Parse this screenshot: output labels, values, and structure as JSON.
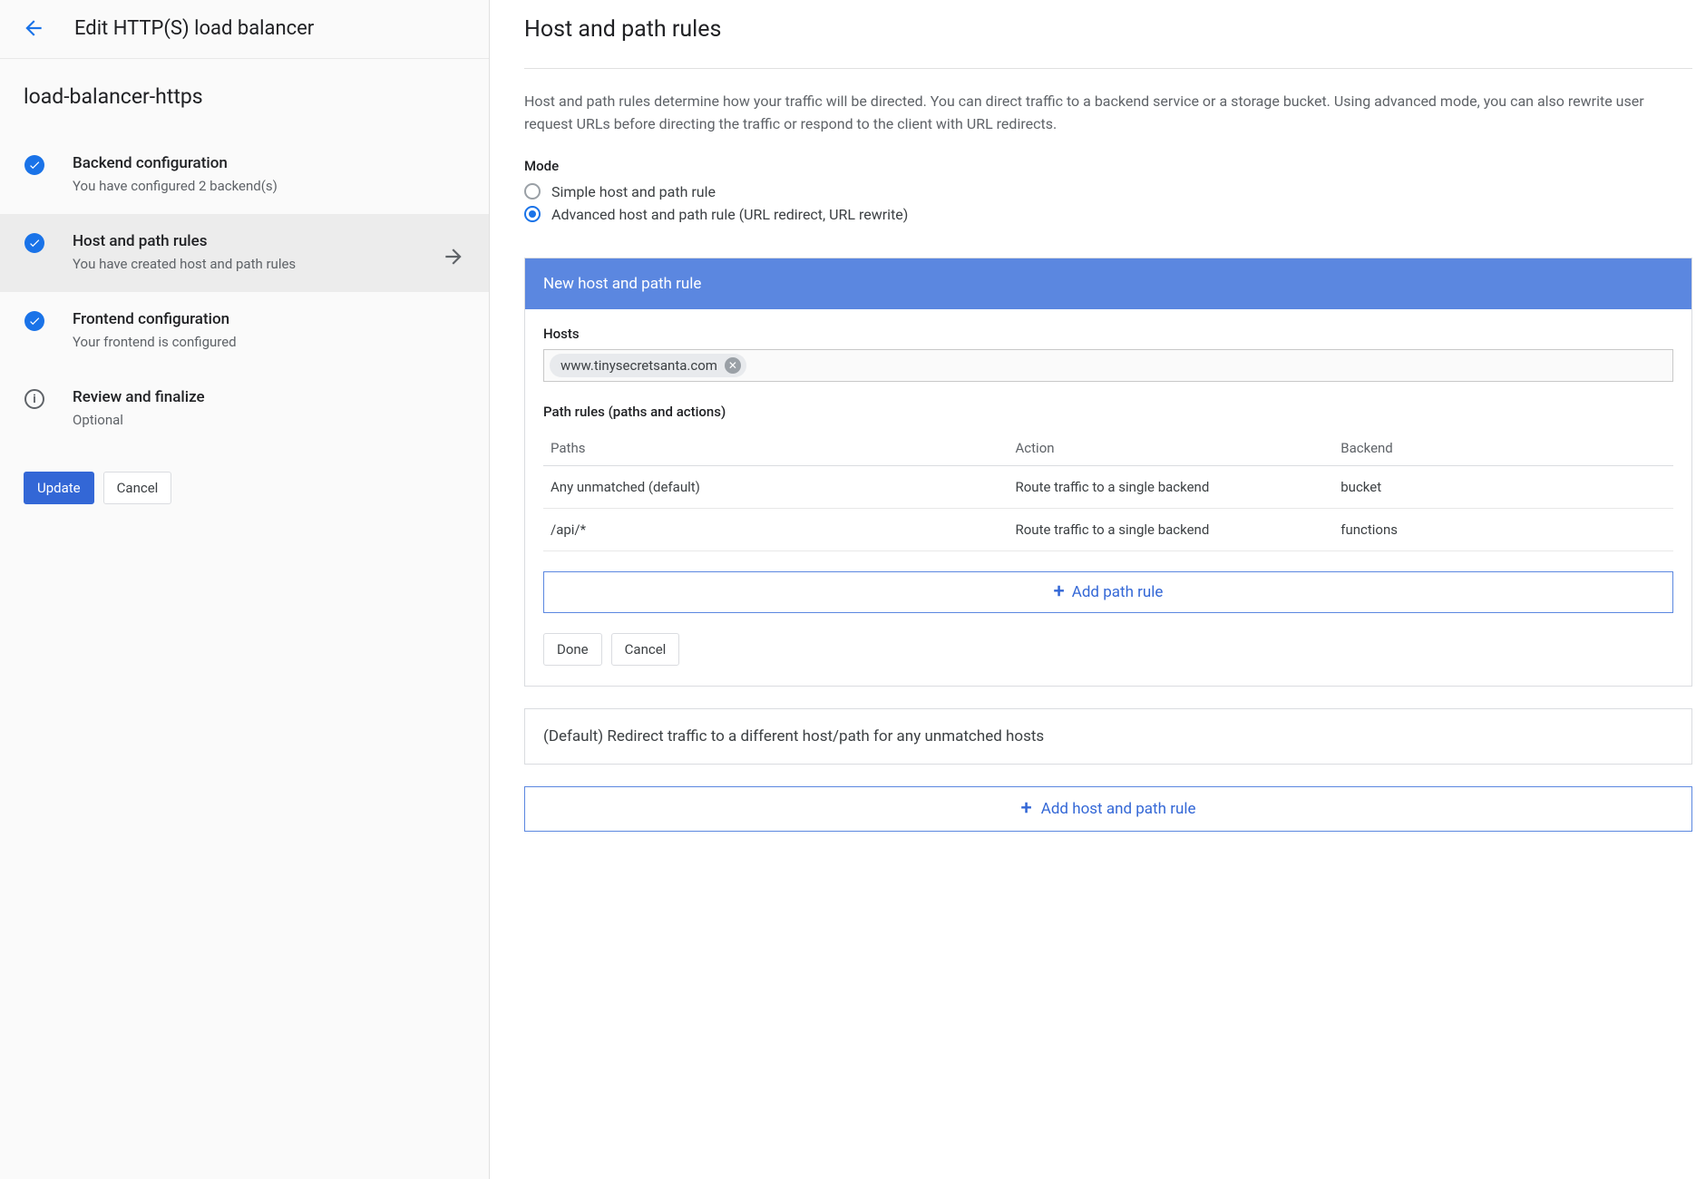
{
  "left": {
    "title": "Edit HTTP(S) load balancer",
    "name": "load-balancer-https",
    "steps": [
      {
        "title": "Backend configuration",
        "sub": "You have configured 2 backend(s)",
        "icon": "check"
      },
      {
        "title": "Host and path rules",
        "sub": "You have created host and path rules",
        "icon": "check",
        "active": true
      },
      {
        "title": "Frontend configuration",
        "sub": "Your frontend is configured",
        "icon": "check"
      },
      {
        "title": "Review and finalize",
        "sub": "Optional",
        "icon": "info"
      }
    ],
    "update": "Update",
    "cancel": "Cancel"
  },
  "right": {
    "title": "Host and path rules",
    "desc": "Host and path rules determine how your traffic will be directed. You can direct traffic to a backend service or a storage bucket. Using advanced mode, you can also rewrite user request URLs before directing the traffic or respond to the client with URL redirects.",
    "mode_label": "Mode",
    "mode": {
      "simple": "Simple host and path rule",
      "advanced": "Advanced host and path rule (URL redirect, URL rewrite)"
    },
    "rule": {
      "header": "New host and path rule",
      "hosts_label": "Hosts",
      "host_chip": "www.tinysecretsanta.com",
      "path_rules_label": "Path rules (paths and actions)",
      "columns": {
        "paths": "Paths",
        "action": "Action",
        "backend": "Backend"
      },
      "rows": [
        {
          "paths": "Any unmatched (default)",
          "action": "Route traffic to a single backend",
          "backend": "bucket"
        },
        {
          "paths": "/api/*",
          "action": "Route traffic to a single backend",
          "backend": "functions"
        }
      ],
      "add_path": "Add path rule",
      "done": "Done",
      "cancel": "Cancel"
    },
    "default_rule": "(Default) Redirect traffic to a different host/path for any unmatched hosts",
    "add_host_rule": "Add host and path rule"
  }
}
